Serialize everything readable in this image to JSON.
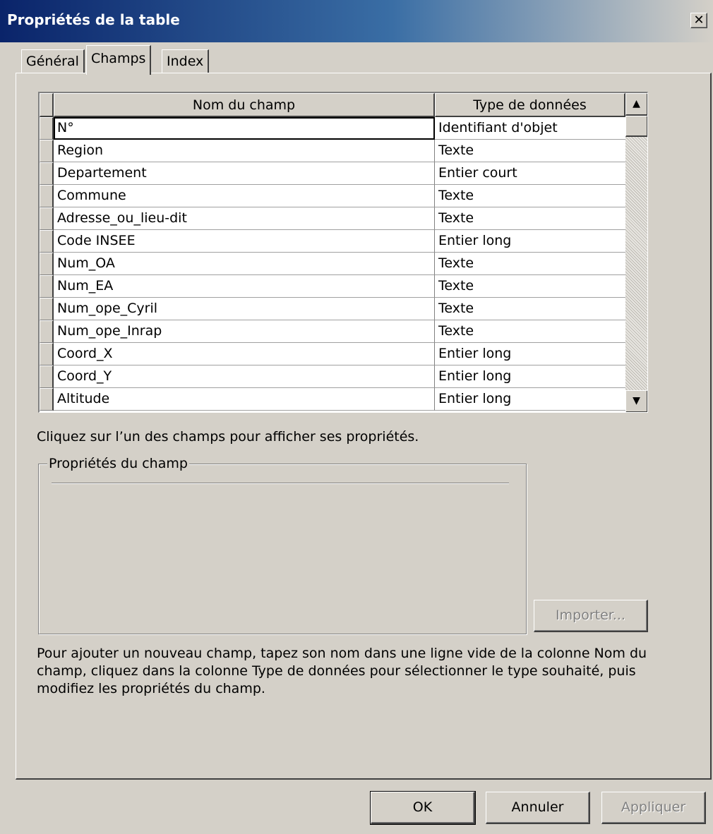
{
  "window": {
    "title": "Propriétés de la table",
    "close_glyph": "✕"
  },
  "tabs": [
    {
      "label": "Général",
      "active": false
    },
    {
      "label": "Champs",
      "active": true
    },
    {
      "label": "Index",
      "active": false
    }
  ],
  "grid": {
    "columns": [
      "Nom du champ",
      "Type de données"
    ],
    "rows": [
      {
        "name": "N°",
        "type": "Identifiant d'objet"
      },
      {
        "name": "Region",
        "type": "Texte"
      },
      {
        "name": "Departement",
        "type": "Entier court"
      },
      {
        "name": "Commune",
        "type": "Texte"
      },
      {
        "name": "Adresse_ou_lieu-dit",
        "type": "Texte"
      },
      {
        "name": "Code INSEE",
        "type": "Entier long"
      },
      {
        "name": "Num_OA",
        "type": "Texte"
      },
      {
        "name": "Num_EA",
        "type": "Texte"
      },
      {
        "name": "Num_ope_Cyril",
        "type": "Texte"
      },
      {
        "name": "Num_ope_Inrap",
        "type": "Texte"
      },
      {
        "name": "Coord_X",
        "type": "Entier long"
      },
      {
        "name": "Coord_Y",
        "type": "Entier long"
      },
      {
        "name": "Altitude",
        "type": "Entier long"
      }
    ],
    "scroll_up_icon": "scroll-up-arrow-icon",
    "scroll_down_icon": "scroll-down-arrow-icon"
  },
  "hint_text": "Cliquez sur l’un des champs pour afficher ses propriétés.",
  "field_properties": {
    "legend": "Propriétés du champ"
  },
  "import_button": "Importer...",
  "help_text": "Pour ajouter un nouveau champ, tapez son nom dans une ligne vide de la colonne Nom du champ, cliquez dans la colonne Type de données pour sélectionner le type souhaité, puis modifiez les propriétés du champ.",
  "buttons": {
    "ok": "OK",
    "cancel": "Annuler",
    "apply": "Appliquer"
  }
}
